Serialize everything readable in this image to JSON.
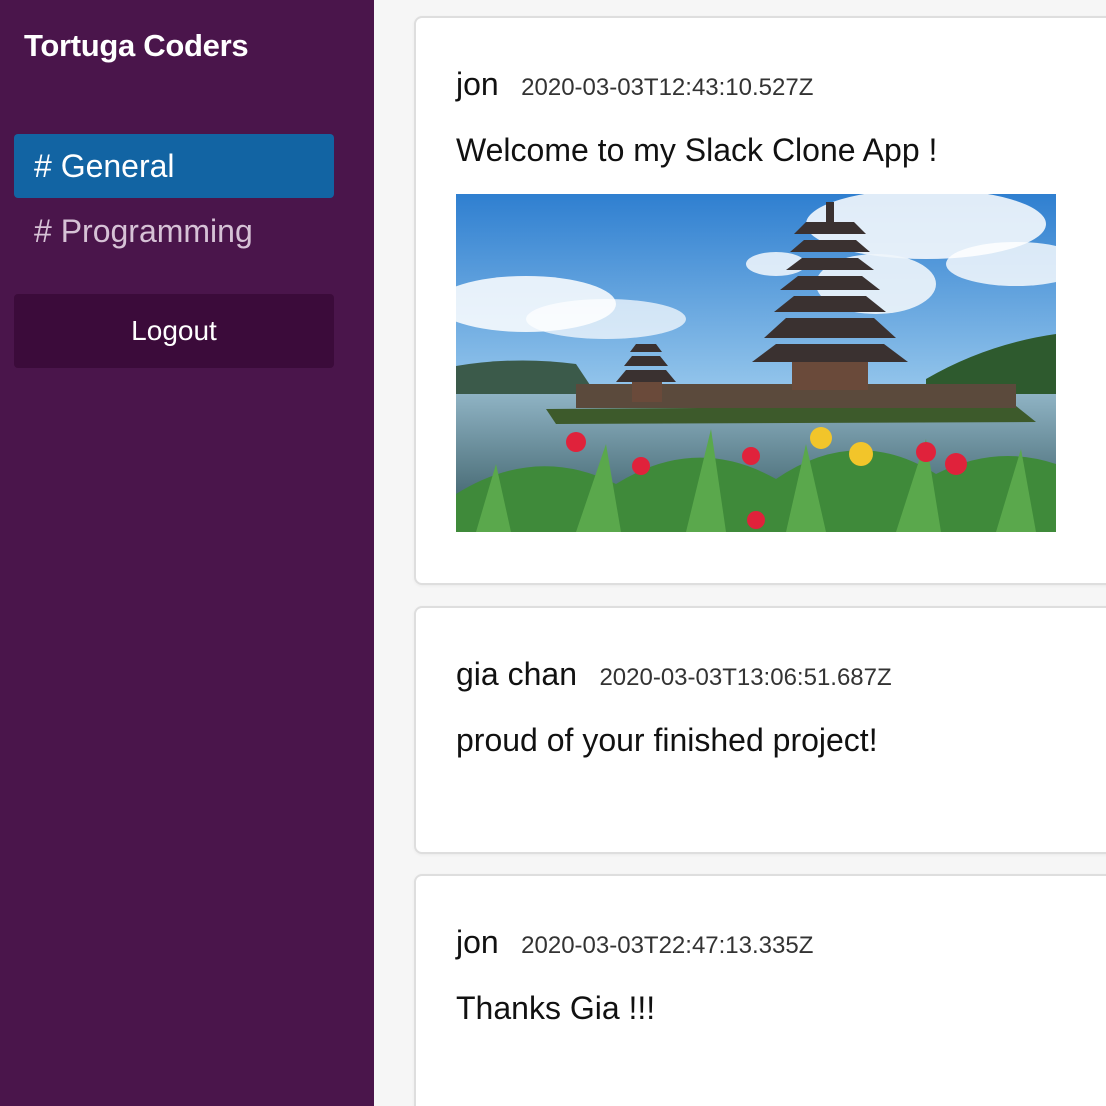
{
  "workspace": {
    "name": "Tortuga Coders"
  },
  "channels": [
    {
      "label": "# General",
      "active": true
    },
    {
      "label": "# Programming",
      "active": false
    }
  ],
  "logout_label": "Logout",
  "colors": {
    "sidebar": "#4a154b",
    "active_channel": "#1264a3",
    "logout_bg": "#3b0b3a"
  },
  "messages": [
    {
      "author": "jon",
      "timestamp": "2020-03-03T12:43:10.527Z",
      "text": "Welcome to my Slack Clone App !",
      "has_image": true
    },
    {
      "author": "gia chan",
      "timestamp": "2020-03-03T13:06:51.687Z",
      "text": "proud of your finished project!"
    },
    {
      "author": "jon",
      "timestamp": "2020-03-03T22:47:13.335Z",
      "text": "Thanks Gia !!!"
    }
  ]
}
